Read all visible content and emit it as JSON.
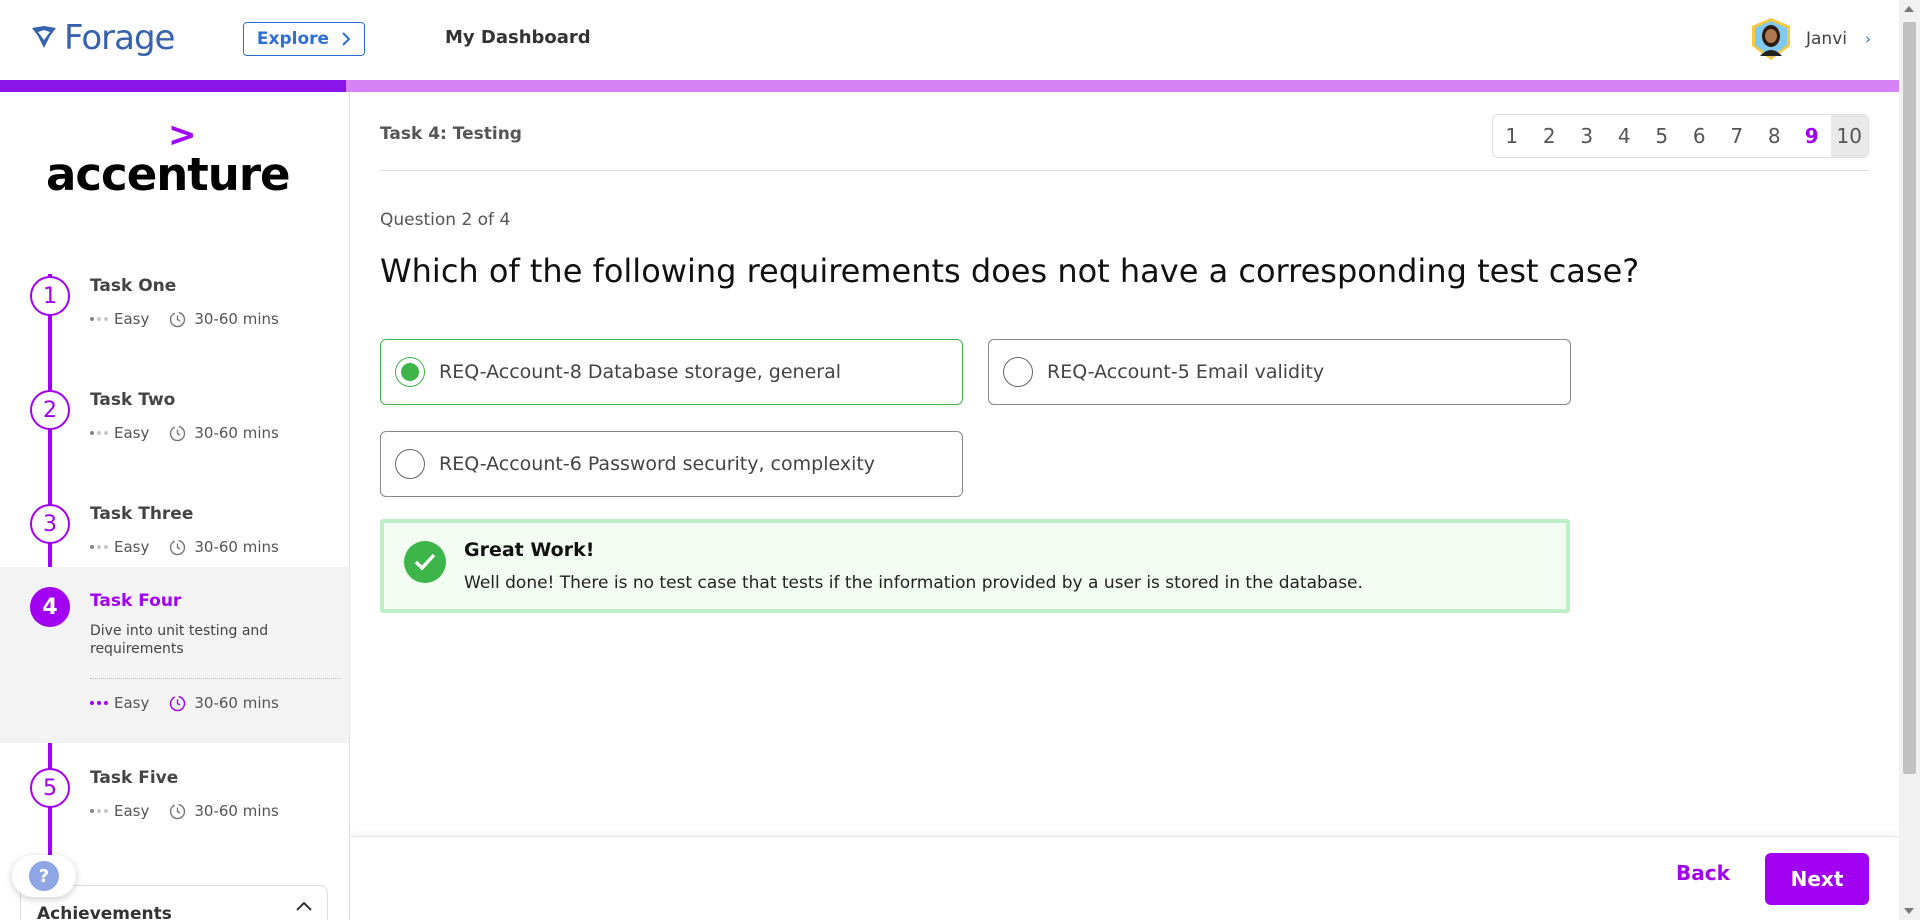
{
  "header": {
    "brand": "Forage",
    "explore_label": "Explore",
    "dashboard_label": "My Dashboard",
    "user_name": "Janvi"
  },
  "progress": {
    "fraction": 0.182
  },
  "sidebar": {
    "company": "accenture",
    "tasks": [
      {
        "number": "1",
        "title": "Task One",
        "difficulty": "Easy",
        "duration": "30-60 mins"
      },
      {
        "number": "2",
        "title": "Task Two",
        "difficulty": "Easy",
        "duration": "30-60 mins"
      },
      {
        "number": "3",
        "title": "Task Three",
        "difficulty": "Easy",
        "duration": "30-60 mins"
      },
      {
        "number": "4",
        "title": "Task Four",
        "description": "Dive into unit testing and requirements",
        "difficulty": "Easy",
        "duration": "30-60 mins",
        "active": true
      },
      {
        "number": "5",
        "title": "Task Five",
        "difficulty": "Easy",
        "duration": "30-60 mins"
      }
    ],
    "achievements_label": "Achievements",
    "help_label": "?"
  },
  "main": {
    "task_heading": "Task 4: Testing",
    "pages": [
      "1",
      "2",
      "3",
      "4",
      "5",
      "6",
      "7",
      "8",
      "9",
      "10"
    ],
    "current_page": "9",
    "question_count": "Question 2 of 4",
    "question": "Which of the following requirements does not have a corresponding test case?",
    "options": [
      {
        "label": "REQ-Account-8 Database storage, general",
        "selected": true
      },
      {
        "label": "REQ-Account-5 Email validity",
        "selected": false
      },
      {
        "label": "REQ-Account-6 Password security, complexity",
        "selected": false
      }
    ],
    "feedback": {
      "title": "Great Work!",
      "text": "Well done! There is no test case that tests if the information provided by a user is stored in the database."
    }
  },
  "footer": {
    "back_label": "Back",
    "next_label": "Next"
  },
  "colors": {
    "accent": "#a200f0",
    "brand_blue": "#3662b0",
    "success": "#3db54a"
  }
}
